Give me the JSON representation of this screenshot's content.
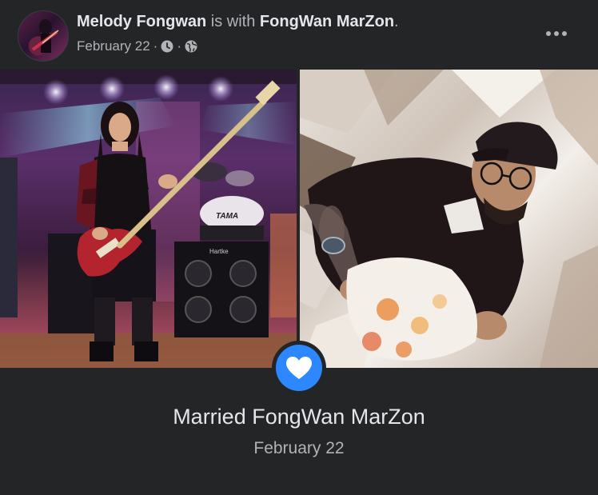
{
  "post": {
    "author": "Melody Fongwan",
    "with_text": "is with",
    "tagged": "FongWan MarZon",
    "period": ".",
    "date": "February 22",
    "separator": "·",
    "time_icon": "clock-icon",
    "audience_icon": "globe-icon",
    "more_icon": "more-options-icon"
  },
  "life_event": {
    "title": "Married FongWan MarZon",
    "date": "February 22",
    "icon": "heart-icon",
    "badge_color": "#2d88ff"
  },
  "photos": {
    "left_label": "TAMA",
    "left_amp_label": "Hartke"
  },
  "colors": {
    "background": "#242526",
    "primary_text": "#e4e6eb",
    "secondary_text": "#b0b3b8"
  }
}
